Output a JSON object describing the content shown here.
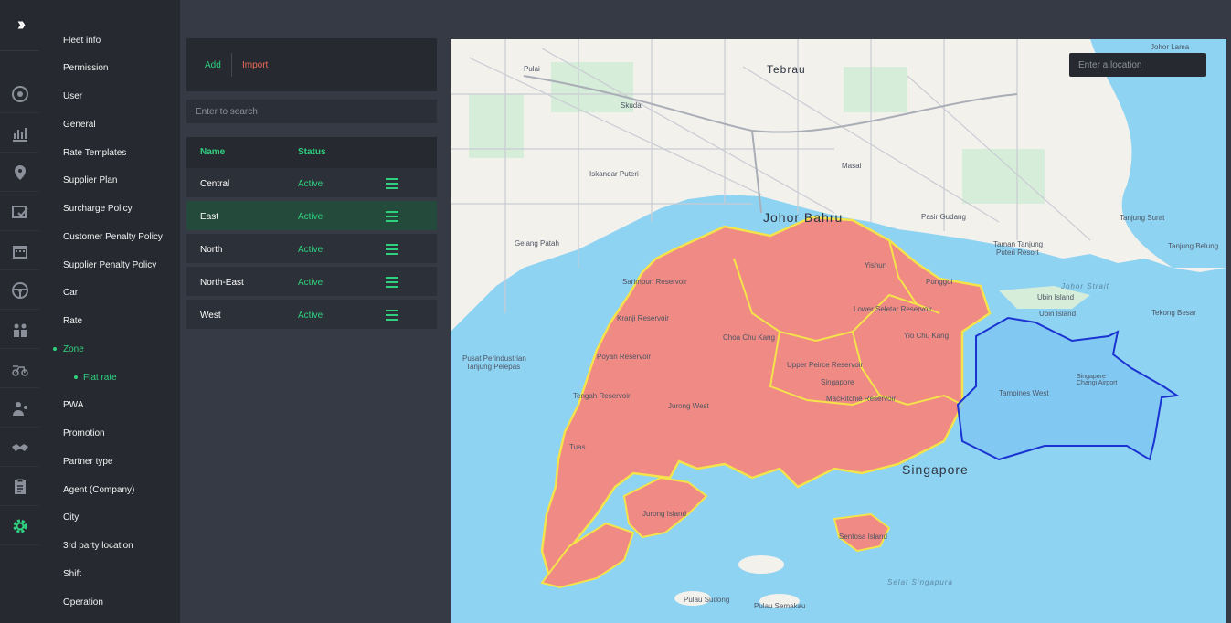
{
  "menu": {
    "items": [
      "Fleet info",
      "Permission",
      "User",
      "General",
      "Rate Templates",
      "Supplier Plan",
      "Surcharge Policy",
      "Customer Penalty Policy",
      "Supplier Penalty Policy",
      "Car",
      "Rate",
      "Zone",
      "Flat rate",
      "PWA",
      "Promotion",
      "Partner type",
      "Agent (Company)",
      "City",
      "3rd party location",
      "Shift",
      "Operation"
    ]
  },
  "toolbar": {
    "add_label": "Add",
    "import_label": "Import"
  },
  "search": {
    "placeholder": "Enter to search"
  },
  "table": {
    "headers": [
      "Name",
      "Status"
    ],
    "rows": [
      {
        "name": "Central",
        "status": "Active"
      },
      {
        "name": "East",
        "status": "Active"
      },
      {
        "name": "North",
        "status": "Active"
      },
      {
        "name": "North-East",
        "status": "Active"
      },
      {
        "name": "West",
        "status": "Active"
      }
    ]
  },
  "map": {
    "location_placeholder": "Enter a location",
    "labels": {
      "johor_lama": "Johor Lama",
      "pulai": "Pulai",
      "tebrau": "Tebrau",
      "skudai": "Skudai",
      "iskandar_puteri": "Iskandar Puteri",
      "masai": "Masai",
      "johor_bahru": "Johor Bahru",
      "pasir_gudang": "Pasir Gudang",
      "tanjung_surat": "Tanjung Surat",
      "gelang_patah": "Gelang Patah",
      "taman_tanjung": "Taman Tanjung",
      "puteri_resort": "Puteri Resort",
      "tanjung_belungkor": "Tanjung Belung",
      "johor_strait": "Johor Strait",
      "ubin_island": "Ubin Island",
      "tekong_besar": "Tekong Besar",
      "pusat_perindustrian": "Pusat Perindustrian",
      "tanjung_pelepas": "Tanjung Pelepas",
      "yishun": "Yishun",
      "lower_seletar": "Lower Seletar Reservoir",
      "punggol": "Punggol",
      "yio_chu_kang": "Yio Chu Kang",
      "choa_chu_kang": "Choa Chu Kang",
      "upper_peirce": "Upper Peirce Reservoir",
      "singapore_small": "Singapore",
      "jurong_west": "Jurong West",
      "macritchie": "MacRitchie Reservoir",
      "tampines_west": "Tampines West",
      "changi_airport": "Singapore Changi Airport",
      "singapore": "Singapore",
      "jurong_island": "Jurong Island",
      "sentosa": "Sentosa Island",
      "selat_singapura": "Selat Singapura",
      "pulau_sudong": "Pulau Sudong",
      "pulau_semakau": "Pulau Semakau",
      "tengah": "Tengah Reservoir",
      "kranji": "Kranji Reservoir",
      "sarimbun": "Sarimbun Reservoir",
      "poyan": "Poyan Reservoir",
      "tuas": "Tuas"
    }
  },
  "colors": {
    "accent": "#2fd17f",
    "import": "#ef6b57",
    "zone_fill": "#f08a84",
    "zone_border": "#f4e34a",
    "selected_zone": "#7fc6f2"
  }
}
